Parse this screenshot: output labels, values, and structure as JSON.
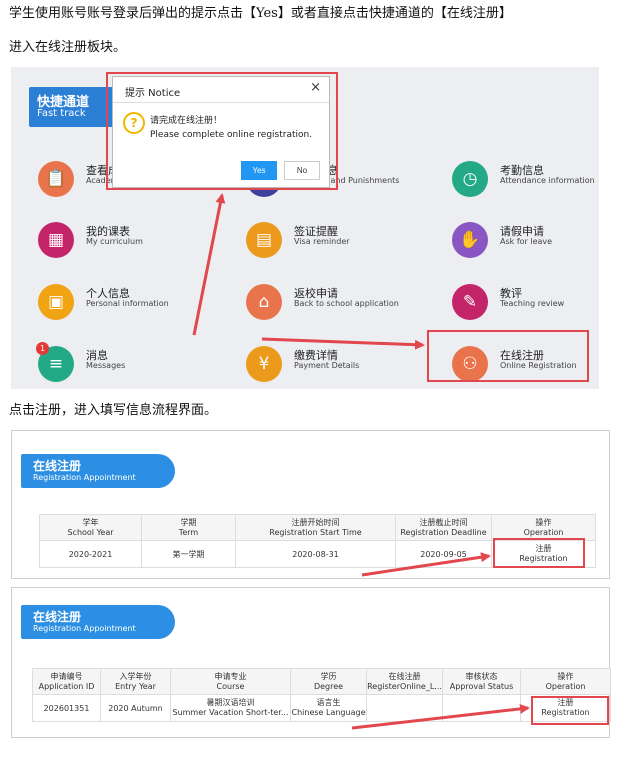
{
  "intro_text": "学生使用账号账号登录后弹出的提示点击【Yes】或者直接点击快捷通道的【在线注册】",
  "intro_text_2": "进入在线注册板块。",
  "middle_text": "点击注册，进入填写信息流程界面。",
  "fast_track": {
    "title_zh": "快捷通道",
    "title_en": "Fast track",
    "items": [
      {
        "zh": "查看成绩",
        "en": "Academic",
        "color": "#e9744b",
        "icon": "📋"
      },
      {
        "zh": "奖惩信息",
        "en": "Rewards and Punishments",
        "color": "#3b3f9e",
        "icon": "★"
      },
      {
        "zh": "考勤信息",
        "en": "Attendance information",
        "color": "#24a987",
        "icon": "◷"
      },
      {
        "zh": "我的课表",
        "en": "My curriculum",
        "color": "#c4246a",
        "icon": "▦"
      },
      {
        "zh": "签证提醒",
        "en": "Visa reminder",
        "color": "#eb9a1c",
        "icon": "▤"
      },
      {
        "zh": "请假申请",
        "en": "Ask for leave",
        "color": "#8a56c2",
        "icon": "✋"
      },
      {
        "zh": "个人信息",
        "en": "Personal information",
        "color": "#f0a313",
        "icon": "▣"
      },
      {
        "zh": "返校申请",
        "en": "Back to school application",
        "color": "#e9744b",
        "icon": "⌂"
      },
      {
        "zh": "教评",
        "en": "Teaching review",
        "color": "#c4246a",
        "icon": "✎"
      },
      {
        "zh": "消息",
        "en": "Messages",
        "color": "#24a987",
        "icon": "≡",
        "badge": "1"
      },
      {
        "zh": "缴费详情",
        "en": "Payment Details",
        "color": "#eb9a1c",
        "icon": "¥"
      },
      {
        "zh": "在线注册",
        "en": "Online Registration",
        "color": "#e9744b",
        "icon": "⚇"
      }
    ]
  },
  "dialog": {
    "title": "提示 Notice",
    "close": "×",
    "message_zh": "请完成在线注册！",
    "message_en": "Please complete online registration.",
    "yes": "Yes",
    "no": "No",
    "icon": "?"
  },
  "panel2": {
    "header_zh": "在线注册",
    "header_en": "Registration Appointment",
    "columns": [
      {
        "zh": "学年",
        "en": "School Year"
      },
      {
        "zh": "学期",
        "en": "Term"
      },
      {
        "zh": "注册开始时间",
        "en": "Registration Start Time"
      },
      {
        "zh": "注册截止时间",
        "en": "Registration Deadline"
      },
      {
        "zh": "操作",
        "en": "Operation"
      }
    ],
    "row": [
      "2020-2021",
      "第一学期",
      "2020-08-31",
      "2020-09-05"
    ],
    "action_zh": "注册",
    "action_en": "Registration"
  },
  "panel3": {
    "header_zh": "在线注册",
    "header_en": "Registration Appointment",
    "columns": [
      {
        "zh": "申请编号",
        "en": "Application ID"
      },
      {
        "zh": "入学年份",
        "en": "Entry Year"
      },
      {
        "zh": "申请专业",
        "en": "Course"
      },
      {
        "zh": "学历",
        "en": "Degree"
      },
      {
        "zh": "在线注册",
        "en": "RegisterOnline_L..."
      },
      {
        "zh": "审核状态",
        "en": "Approval Status"
      },
      {
        "zh": "操作",
        "en": "Operation"
      }
    ],
    "row": {
      "id": "202601351",
      "year": "2020 Autumn",
      "course_zh": "暑期汉语培训",
      "course_en": "Summer Vacation Short-ter...",
      "degree_zh": "语言生",
      "degree_en": "Chinese Language",
      "online": "",
      "status": ""
    },
    "action_zh": "注册",
    "action_en": "Registration"
  },
  "colors": {
    "accent": "#2d8fe3",
    "highlight": "#e2474d",
    "arrow": "#e2474d"
  }
}
